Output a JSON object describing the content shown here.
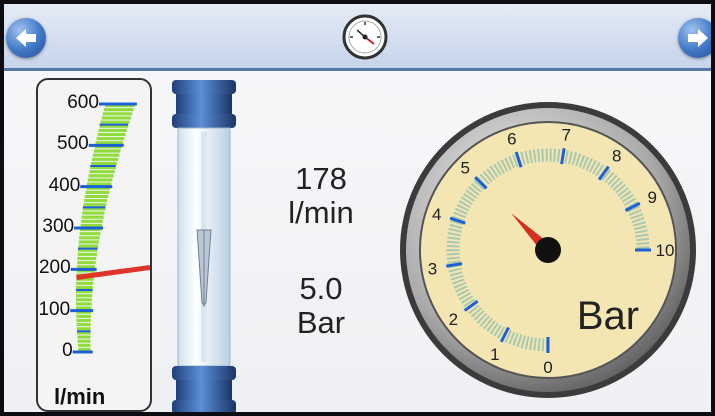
{
  "header": {
    "back_icon": "arrow-left-icon",
    "screen_icon": "pressure-gauge-icon",
    "forward_icon": "arrow-right-icon",
    "accent_color": "#3e76c6"
  },
  "flow_scale": {
    "ticks": [
      "600",
      "500",
      "400",
      "300",
      "200",
      "100",
      "0"
    ],
    "unit": "l/min",
    "max": 600,
    "indicator_value": 190,
    "bar_color": "#8fdc3c",
    "indicator_color": "#e0342a"
  },
  "readings": {
    "flow_value": "178",
    "flow_unit": "l/min",
    "pressure_value": "5.0",
    "pressure_unit": "Bar"
  },
  "pressure_gauge": {
    "ticks": [
      "0",
      "1",
      "2",
      "3",
      "4",
      "5",
      "6",
      "7",
      "8",
      "9",
      "10"
    ],
    "unit": "Bar",
    "max": 10,
    "needle_value": 5.0,
    "dial_color": "#f3e6b3",
    "needle_color": "#d4301f"
  }
}
